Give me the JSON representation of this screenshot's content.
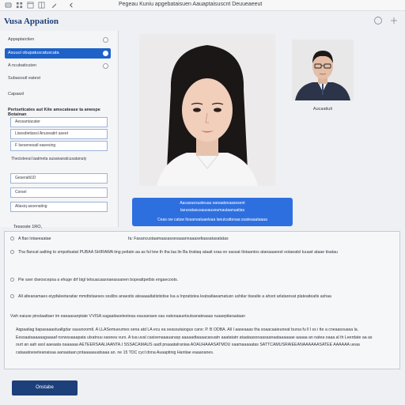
{
  "window": {
    "title": "Pegeau Kuniu apgebataisuen Aauaptaisuscnt Deuueaeeut"
  },
  "header": {
    "app_title": "Vusa Appation"
  },
  "sidebar": {
    "items": [
      {
        "label": "Appaptaictien",
        "active": false
      },
      {
        "label": "Asuuul obupatuscatuscata",
        "active": true
      },
      {
        "label": "A ncubaticuten",
        "active": false
      },
      {
        "label": "Subasoutl eatest",
        "active": false
      },
      {
        "label": "Capaaxl",
        "active": false
      }
    ],
    "section_heading": "Pertseticates aut Kite amscatease ta anwspe Botainan",
    "fields": [
      "Aessantacater",
      "Lisesdietisesl Anuveatirt aseet",
      "F lsesenesatl eaeesing"
    ],
    "note": "Thecisteeut laatmeta ausanaeatcusatanuty",
    "fields2": [
      "Geseralti1D",
      "Corsel",
      "Aliaxiq asoenating"
    ]
  },
  "main": {
    "thumb_label": "Aucaatiuti",
    "info_box": {
      "line1": "Aacaouesusteuau eanaatsnaasesent",
      "line2": "laeusatasusausauseumautaanuatias",
      "line3": "Ceas ow catuw ltosanoatuaelsaa lanutcatteoaa ssateaaataaaa"
    }
  },
  "declaration": {
    "label": "Tessoste 1RO,",
    "options": [
      {
        "text": "A flao lotaeeaatae",
        "right": "fa:  Fasancustaamaasassesaaannaaasetiaasatasatatas"
      },
      {
        "text": "Tha flancat aalting to smpsttsatat PUBAA SHIRAWA ting peitatn aa as ful tew th tha laa lin Ba tiratiaq ataait sraa on sassat tlotaantos atanaaaeest ootaeatsl tuuast ataae tisatau"
      },
      {
        "text": "Pie sser dseoscepsa a ehuge drf bigl tetsuacaasnaeassanen bopeattpetbis engaecoots."
      },
      {
        "text": "All alteanamaes eiypfaleetaratiar mmdtstiaeses ssslibs anaestis ateaaaaltatististise lsa a Inpratistea leatsatlaeamatusn ushilar tisealte a ahsot arlataresat plateaiteatls ashaa"
      }
    ],
    "subheading": "Vwh eaiuse pinstaattaer im eaeaasanptate V VISA sagaaitasetesteau eausanaee sau eatsnaauetsutsanateaaas ruaaepitaraataan",
    "para1": "Pronaurte ahsmmtunal deannaaasmmmeuc ashemorsng noe nigaaattaastu beanwasanaudanttaarts nas na niudta anmaa sisaaahaseanwng bnaaet bnaamsts ahvuaasun wansammatsantnmsuo anl bsantassaau",
    "para2": "Aqpaatiag tiapasaaastuallgdar sauunoomtl. A LLASemueumes sena atd LA ecu ea seassutaiogus cans: P. B ODBA. All I aaseaaas tha soaacaaieuneat bursa fu ll l ss i tte a cneaasouasa la. Eessaataaaaaagaaaaf nsrwsuaaapata ulxatnuu saoeea vurs. A tua uval casisenaaauarasp aaaaadtaaaacasuatn aaatatatn ataataasooaasaanaataaaaaae aaaaa an natea oaaa al th Leerdate aa as ourt an aah assl aaeaata oaaaaaa AETEERSAALIAANTA.I SSSACAMAUS aadl pnaaatalraniaa AOAUHAAASATMOU saamaaaaatas SATTCAMUSRAIEEANAAAAAASATEE AAAAAA ueaa cataaatoeseteanaisaa aanaataan pntaaaaauatsaaa an. ne 15 TDC cycl dona Auaaptinig Hantiae eaaaoanes."
  },
  "actions": {
    "continue_label": "Onstabe"
  },
  "colors": {
    "accent": "#1e62c8",
    "button": "#1d3f7a",
    "info_box": "#2e6fe0"
  }
}
